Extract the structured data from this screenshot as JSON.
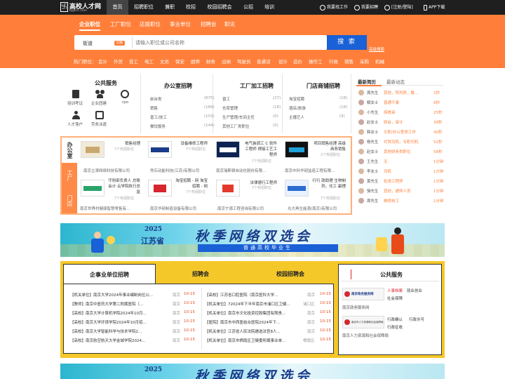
{
  "site": {
    "logo_text": "高校人才网",
    "logo_sub": "bjgxrc.com",
    "logo_mark": "卐"
  },
  "topnav": [
    "首页",
    "招聘职位",
    "兼职",
    "校招",
    "校园招聘会",
    "公招",
    "培训"
  ],
  "toplinks": {
    "find_job": "我要找工作",
    "recruit": "我要招聘",
    "login": "[注册/登陆]",
    "app": "APP下载"
  },
  "search": {
    "tabs": [
      "企业职位",
      "工厂职位",
      "店面职位",
      "事业单位",
      "招聘会",
      "职讯"
    ],
    "location": "街道",
    "location_badge": "切换",
    "placeholder": "请输入职位或公司名称",
    "button": "搜 索",
    "advanced": "高级搜索",
    "hot_label": "热门职位：",
    "hot": [
      "会计",
      "外贸",
      "普工",
      "电工",
      "文员",
      "保安",
      "厨师",
      "财务",
      "出纳",
      "驾驶员",
      "普通话",
      "设计",
      "造价",
      "操作工",
      "行政",
      "销售",
      "采购",
      "机械"
    ]
  },
  "public_services": {
    "title": "公共服务",
    "items": [
      "培训考证",
      "企业团建",
      "rpo",
      "人才落户",
      "劳务派遣"
    ]
  },
  "columns": [
    {
      "title": "办公室招聘",
      "rows": [
        [
          "前台类",
          "(675)"
        ],
        [
          "销售",
          "(189)"
        ],
        [
          "普工/技工",
          "(153)"
        ],
        [
          "餐饮服务",
          "(144)"
        ]
      ]
    },
    {
      "title": "工厂加工招聘",
      "rows": [
        [
          "普工",
          "(27)"
        ],
        [
          "仓库管理",
          "(18)"
        ],
        [
          "生产管理/车间主任",
          "(0)"
        ],
        [
          "其他工厂类职位",
          "(0)"
        ]
      ]
    },
    {
      "title": "门店商铺招聘",
      "rows": [
        [
          "淘宝招聘",
          "(18)"
        ],
        [
          "酒店/旅游",
          "(18)"
        ],
        [
          "主播艺人",
          "(9)"
        ]
      ]
    }
  ],
  "cat_tabs": [
    "办公室",
    "工厂",
    "门店"
  ],
  "companies": [
    {
      "job": "销售经理",
      "count": "7个热招职位",
      "name": "南京立津网络科技有限公司"
    },
    {
      "job": "设备维修工程师",
      "count": "7个热招职位",
      "name": "然石动能科技(江苏)有限公司"
    },
    {
      "job": "电气装调工 C 软件工程师 焊接工艺工程师",
      "count": "7个热招职位",
      "name": "南京瑞斯顿自动化股份有限..."
    },
    {
      "job": "项目销售经理 高级商务销售",
      "count": "2个热招职位",
      "name": "南京中科华韧监造工程有限..."
    },
    {
      "job": "守则部负责人 总账会计 云学院执行总监",
      "count": "7个热招职位",
      "name": "南京世界村健康智慧零售有..."
    },
    {
      "job": "淘宝招聘 - 网 淘宝招聘 - 网",
      "count": "7个热招职位",
      "name": "南京华研制造设备有限公司"
    },
    {
      "job": "法律德行工程师",
      "count": "7个热招职位",
      "name": "南京宁源工程咨询有限公司"
    },
    {
      "job": "行行 政助理 生物制药、化工 副理",
      "count": "7个热招职位",
      "name": "光大再生能源(南京)有限公司"
    }
  ],
  "resumes": {
    "tabs": [
      "最新简历",
      "最新动态"
    ],
    "list": [
      {
        "name": "周先生",
        "job": "其他，阵列房，氟...",
        "time": "1秒"
      },
      {
        "name": "解女士",
        "job": "普通干事",
        "time": "6秒"
      },
      {
        "name": "小先生",
        "job": "捞裹袋",
        "time": "25秒"
      },
      {
        "name": "赵女士",
        "job": "财会，审计",
        "time": "39秒"
      },
      {
        "name": "韩女士",
        "job": "文职/办公室类工作",
        "time": "40秒"
      },
      {
        "name": "杨先生",
        "job": "代驾司机，专职司机",
        "time": "52秒"
      },
      {
        "name": "赵女士",
        "job": "其他财务类职位",
        "time": "58秒"
      },
      {
        "name": "王先生",
        "job": "无",
        "time": "1分钟"
      },
      {
        "name": "李女士",
        "job": "司机",
        "time": "1分钟"
      },
      {
        "name": "黄先生",
        "job": "检测工程师",
        "time": "1分钟"
      },
      {
        "name": "骆先生",
        "job": "其他，遴师人员",
        "time": "1分钟"
      },
      {
        "name": "周先生",
        "job": "维修技工",
        "time": "1分钟"
      }
    ]
  },
  "promo": {
    "year": "2025",
    "region": "江苏省",
    "title": "秋季网络双选会",
    "subtitle": "普通高校毕业生"
  },
  "jobs_section": {
    "tabs": [
      "企事业单位招聘",
      "招聘会",
      "校园招聘会"
    ],
    "left": [
      {
        "title": "【机关单位】南京大学2024年事业编制岗位公...",
        "city": "南京",
        "date": "10-15"
      },
      {
        "title": "【教师】南京中医药大学第二附属医院（...",
        "city": "南京",
        "date": "10-15"
      },
      {
        "title": "【高校】南京大学计算机学院2024年10月...",
        "city": "南京",
        "date": "10-15"
      },
      {
        "title": "【高校】南京大学环境学院2024年10月招...",
        "city": "南京",
        "date": "10-15"
      },
      {
        "title": "【高校】南京大学智能科学与技术学院2...",
        "city": "南京",
        "date": "10-15"
      },
      {
        "title": "【高校】南京航空航天大学金城学院2024...",
        "city": "南京",
        "date": "10-15"
      }
    ],
    "right": [
      {
        "title": "【高校】江苏省口腔医院（南京医科大学...",
        "city": "南京",
        "date": "10-15"
      },
      {
        "title": "【机关单位】72024年下半年南京市浦口区卫健...",
        "city": "浦口区",
        "date": "10-15"
      },
      {
        "title": "【机关单位】南京市文化投资控股集团有限责...",
        "city": "南京",
        "date": "10-15"
      },
      {
        "title": "【医院】南京市中西医结合医院2024年下...",
        "city": "南京",
        "date": "10-15"
      },
      {
        "title": "【机关单位】江苏省人民法院遴选法官8人...",
        "city": "南京",
        "date": "10-15"
      },
      {
        "title": "【机关单位】南京市栖霞区卫健委所属事业单...",
        "city": "栖霞区",
        "date": "10-15"
      }
    ]
  },
  "gov_services": {
    "title": "公共服务",
    "blocks": [
      {
        "logo": "南京政务服务网",
        "name": "南京政务服务网",
        "links": [
          "人事档案",
          "就业创业",
          "社会保障"
        ]
      },
      {
        "logo": "南京市人力资源和社会保障局",
        "name": "南京人力资源和社会保障局",
        "links": [
          "行政确认",
          "行政许可",
          "行政征收"
        ]
      }
    ]
  },
  "colors": {
    "accent": "#ff7f3a",
    "dark": "#1f1f1f",
    "blue": "#1a60d6",
    "promo": "#f5c82a"
  }
}
